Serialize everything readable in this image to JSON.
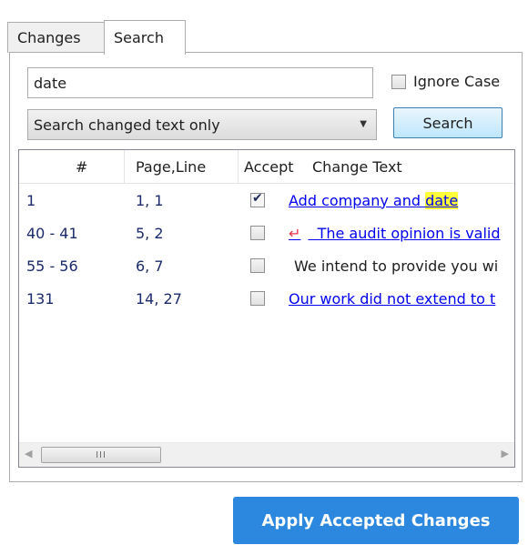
{
  "tabs": [
    {
      "label": "Changes"
    },
    {
      "label": "Search"
    }
  ],
  "search": {
    "query": "date",
    "ignore_case_label": "Ignore Case",
    "ignore_case_checked": false,
    "scope_selected": "Search changed text only",
    "button_label": "Search"
  },
  "table": {
    "columns": [
      "#",
      "Page,Line",
      "Accept",
      "Change Text"
    ],
    "rows": [
      {
        "num": "1",
        "page_line": "1, 1",
        "accepted": true,
        "text_before": "Add company and ",
        "text_highlight": "date",
        "style": "link"
      },
      {
        "num": "40 - 41",
        "page_line": "5, 2",
        "accepted": false,
        "marker": "↵",
        "text_before": "  The audit opinion is valid",
        "text_highlight": "",
        "style": "link"
      },
      {
        "num": "55 - 56",
        "page_line": "6, 7",
        "accepted": false,
        "text_before": "We intend to provide you wi",
        "text_highlight": "",
        "style": "plain"
      },
      {
        "num": "131",
        "page_line": "14, 27",
        "accepted": false,
        "text_before": "Our work did not extend to t",
        "text_highlight": "",
        "style": "link"
      }
    ]
  },
  "scrollbar": {
    "grip": "III"
  },
  "apply_button_label": "Apply Accepted Changes",
  "colors": {
    "link": "#0000ee",
    "highlight": "#ffff3a",
    "apply_bg": "#2c88de",
    "marker": "#e8364a"
  }
}
